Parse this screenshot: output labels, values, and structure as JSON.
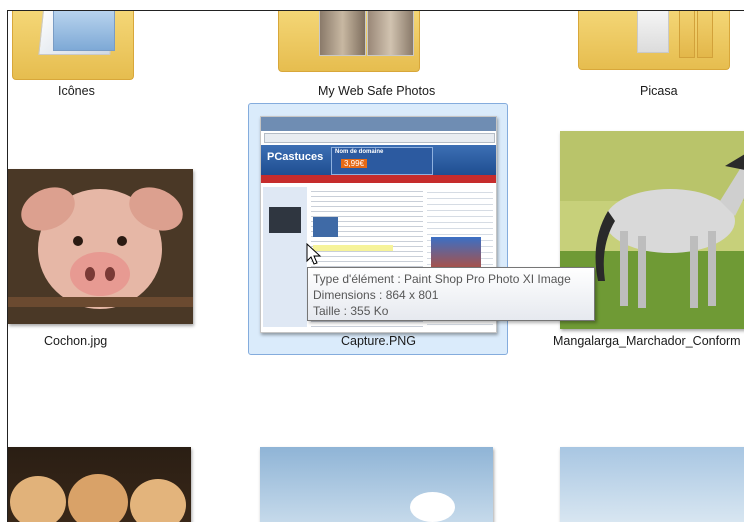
{
  "items_row1": [
    {
      "label": "Icônes"
    },
    {
      "label": "My Web Safe Photos"
    },
    {
      "label": "Picasa"
    }
  ],
  "items_row2": [
    {
      "label": "Cochon.jpg"
    },
    {
      "label": "Capture.PNG"
    },
    {
      "label": "Mangalarga_Marchador_Conform"
    }
  ],
  "tooltip": {
    "line1": "Type d'élément : Paint Shop Pro Photo XI Image",
    "line2": "Dimensions : 864 x 801",
    "line3": "Taille : 355 Ko"
  },
  "screenshot_thumb": {
    "site_name": "PCastuces",
    "banner_text": "Nom de domaine",
    "banner_price": "3,99€"
  },
  "colors": {
    "selection": "#cde4fa",
    "selection_border": "#84acdd",
    "folder": "#f2d06b"
  }
}
